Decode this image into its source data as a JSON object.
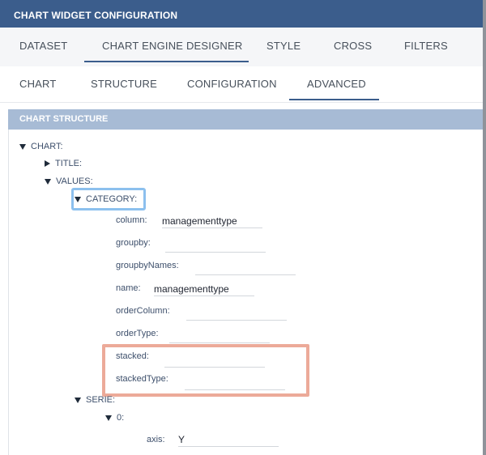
{
  "window": {
    "title": "CHART WIDGET CONFIGURATION"
  },
  "main_tabs": [
    {
      "label": "DATASET"
    },
    {
      "label": "CHART ENGINE DESIGNER"
    },
    {
      "label": "STYLE"
    },
    {
      "label": "CROSS"
    },
    {
      "label": "FILTERS"
    }
  ],
  "sub_tabs": [
    {
      "label": "CHART"
    },
    {
      "label": "STRUCTURE"
    },
    {
      "label": "CONFIGURATION"
    },
    {
      "label": "ADVANCED"
    }
  ],
  "section": {
    "title": "CHART STRUCTURE"
  },
  "tree": {
    "chart": "CHART:",
    "title": "TITLE:",
    "values": "VALUES:",
    "category": {
      "label": "CATEGORY:",
      "props": [
        {
          "key": "column:",
          "value": "managementtype"
        },
        {
          "key": "groupby:",
          "value": ""
        },
        {
          "key": "groupbyNames:",
          "value": ""
        },
        {
          "key": "name:",
          "value": "managementtype"
        },
        {
          "key": "orderColumn:",
          "value": ""
        },
        {
          "key": "orderType:",
          "value": ""
        },
        {
          "key": "stacked:",
          "value": ""
        },
        {
          "key": "stackedType:",
          "value": ""
        }
      ]
    },
    "serie": "SERIE:",
    "serie_index": "0:",
    "axis": {
      "key": "axis:",
      "value": "Y"
    }
  }
}
